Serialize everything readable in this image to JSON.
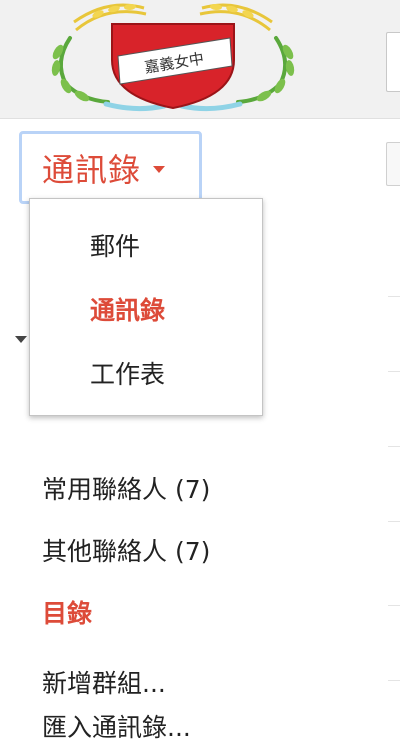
{
  "header": {
    "logo_text": "嘉義女中"
  },
  "app_switcher": {
    "label": "通訊錄"
  },
  "menu": {
    "items": [
      {
        "label": "郵件",
        "active": false
      },
      {
        "label": "通訊錄",
        "active": true
      },
      {
        "label": "工作表",
        "active": false
      }
    ]
  },
  "nav": {
    "starred": "常用聯絡人 (7)",
    "other": "其他聯絡人 (7)",
    "section_title": "目錄",
    "new_group": "新增群組...",
    "import": "匯入通訊錄..."
  },
  "colors": {
    "accent": "#dd4b39",
    "focus_border": "#b9d3f7",
    "header_bg": "#f1f1f1"
  }
}
